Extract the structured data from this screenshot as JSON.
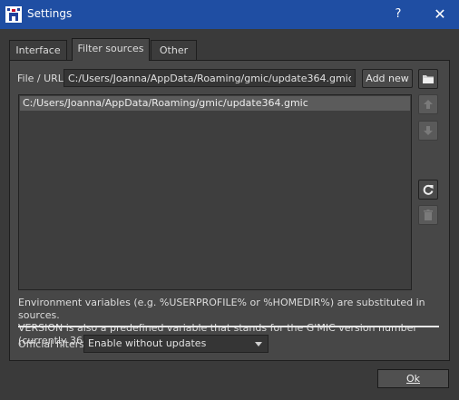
{
  "window": {
    "title": "Settings",
    "help_label": "?",
    "close_label": "✕"
  },
  "tabs": [
    {
      "label": "Interface"
    },
    {
      "label": "Filter sources"
    },
    {
      "label": "Other"
    }
  ],
  "sources": {
    "url_label": "File / URL",
    "url_value": "C:/Users/Joanna/AppData/Roaming/gmic/update364.gmic",
    "add_new_label": "Add new",
    "list": [
      "C:/Users/Joanna/AppData/Roaming/gmic/update364.gmic"
    ],
    "icons": [
      "folder-open-icon",
      "move-up-icon",
      "move-down-icon",
      "reset-icon",
      "delete-icon"
    ]
  },
  "hint": {
    "line1": "Environment variables (e.g. %USERPROFILE% or %HOMEDIR%) are substituted in sources.",
    "line2": "VERSION is also a predefined variable that stands for the G'MIC version number (currently 364)."
  },
  "official_filters": {
    "label": "Official filters:",
    "selected": "Enable without updates"
  },
  "ok_label": "Ok",
  "colors": {
    "titlebar": "#1f4ea3",
    "background": "#3a3a3a",
    "panel": "#474747"
  }
}
